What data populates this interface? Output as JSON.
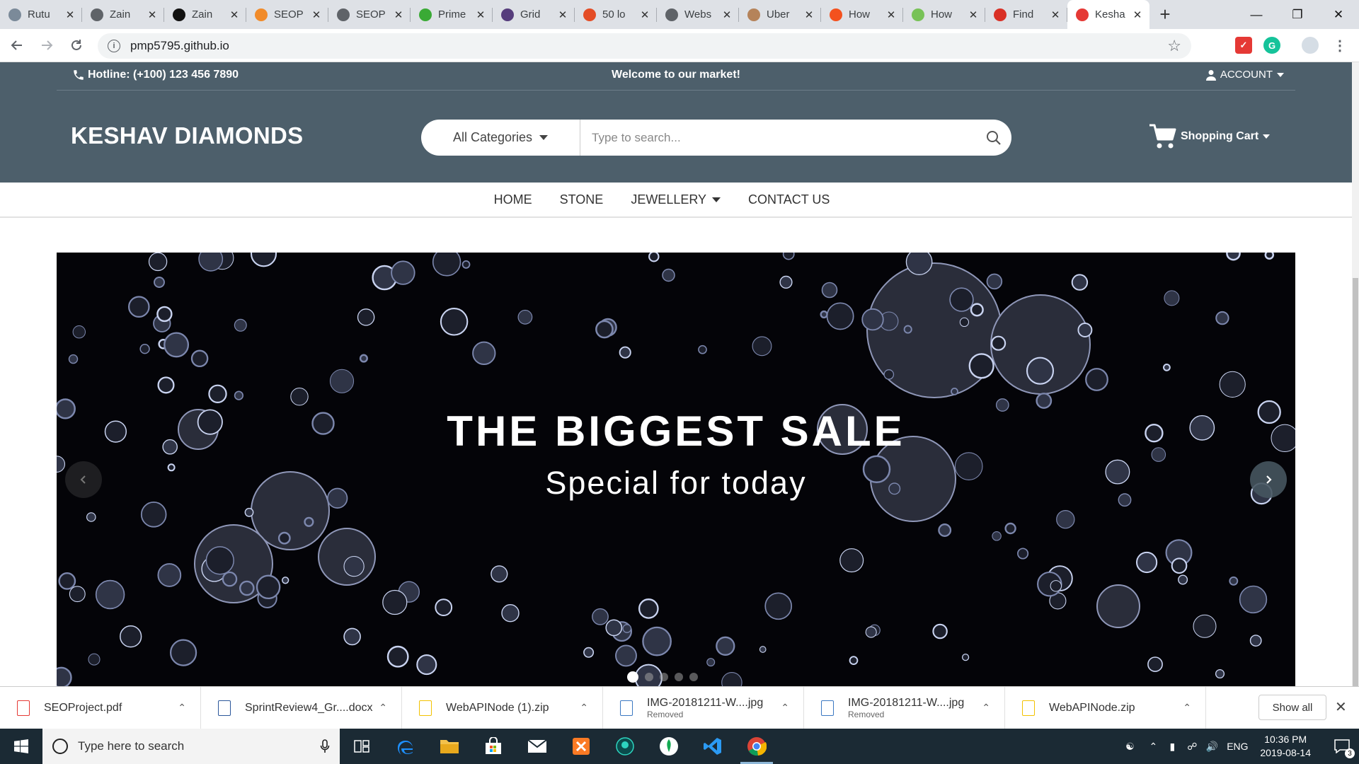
{
  "browser": {
    "tabs": [
      {
        "title": "Rutu",
        "icon": "avatar-favicon",
        "color": "#7b8a99"
      },
      {
        "title": "Zain",
        "icon": "globe-favicon",
        "color": "#5f6368"
      },
      {
        "title": "Zain",
        "icon": "h-logo-favicon",
        "color": "#111111"
      },
      {
        "title": "SEOP",
        "icon": "orange-circle-favicon",
        "color": "#f18b2a"
      },
      {
        "title": "SEOP",
        "icon": "globe-favicon",
        "color": "#5f6368"
      },
      {
        "title": "Prime",
        "icon": "play-favicon",
        "color": "#3aaa35"
      },
      {
        "title": "Grid",
        "icon": "bootstrap-favicon",
        "color": "#563d7c"
      },
      {
        "title": "50 lo",
        "icon": "html5-favicon",
        "color": "#e44d26"
      },
      {
        "title": "Webs",
        "icon": "globe-favicon",
        "color": "#5f6368"
      },
      {
        "title": "Uber",
        "icon": "face-favicon",
        "color": "#b5835a"
      },
      {
        "title": "How",
        "icon": "orange-square-favicon",
        "color": "#f4511e"
      },
      {
        "title": "How",
        "icon": "android-favicon",
        "color": "#78c257"
      },
      {
        "title": "Find",
        "icon": "gmail-favicon",
        "color": "#d93025"
      },
      {
        "title": "Kesha",
        "icon": "k-logo-favicon",
        "color": "#e53935",
        "active": true
      }
    ],
    "new_tab": "+",
    "url": "pmp5795.github.io"
  },
  "site": {
    "hotline": "Hotline: (+100) 123 456 7890",
    "welcome": "Welcome to our market!",
    "account": "ACCOUNT",
    "logo": "KESHAV DIAMONDS",
    "category_select": "All Categories",
    "search_placeholder": "Type to search...",
    "cart": "Shopping Cart",
    "nav": {
      "home": "HOME",
      "stone": "STONE",
      "jewellery": "JEWELLERY",
      "contact": "CONTACT US"
    },
    "slide": {
      "title": "THE BIGGEST SALE",
      "subtitle": "Special for today",
      "slide_count": 5,
      "active_slide": 1
    },
    "colors": {
      "header_bg": "#4d5f6b",
      "slide_bg": "#040408"
    }
  },
  "downloads": {
    "items": [
      {
        "name": "SEOProject.pdf",
        "status": "",
        "icon": "pdf-file-icon"
      },
      {
        "name": "SprintReview4_Gr....docx",
        "status": "",
        "icon": "word-file-icon"
      },
      {
        "name": "WebAPINode (1).zip",
        "status": "",
        "icon": "zip-file-icon"
      },
      {
        "name": "IMG-20181211-W....jpg",
        "status": "Removed",
        "icon": "image-file-icon"
      },
      {
        "name": "IMG-20181211-W....jpg",
        "status": "Removed",
        "icon": "image-file-icon"
      },
      {
        "name": "WebAPINode.zip",
        "status": "",
        "icon": "zip-file-icon"
      }
    ],
    "show_all": "Show all"
  },
  "taskbar": {
    "search_placeholder": "Type here to search",
    "language": "ENG",
    "time": "10:36 PM",
    "date": "2019-08-14",
    "notifications": "3"
  }
}
